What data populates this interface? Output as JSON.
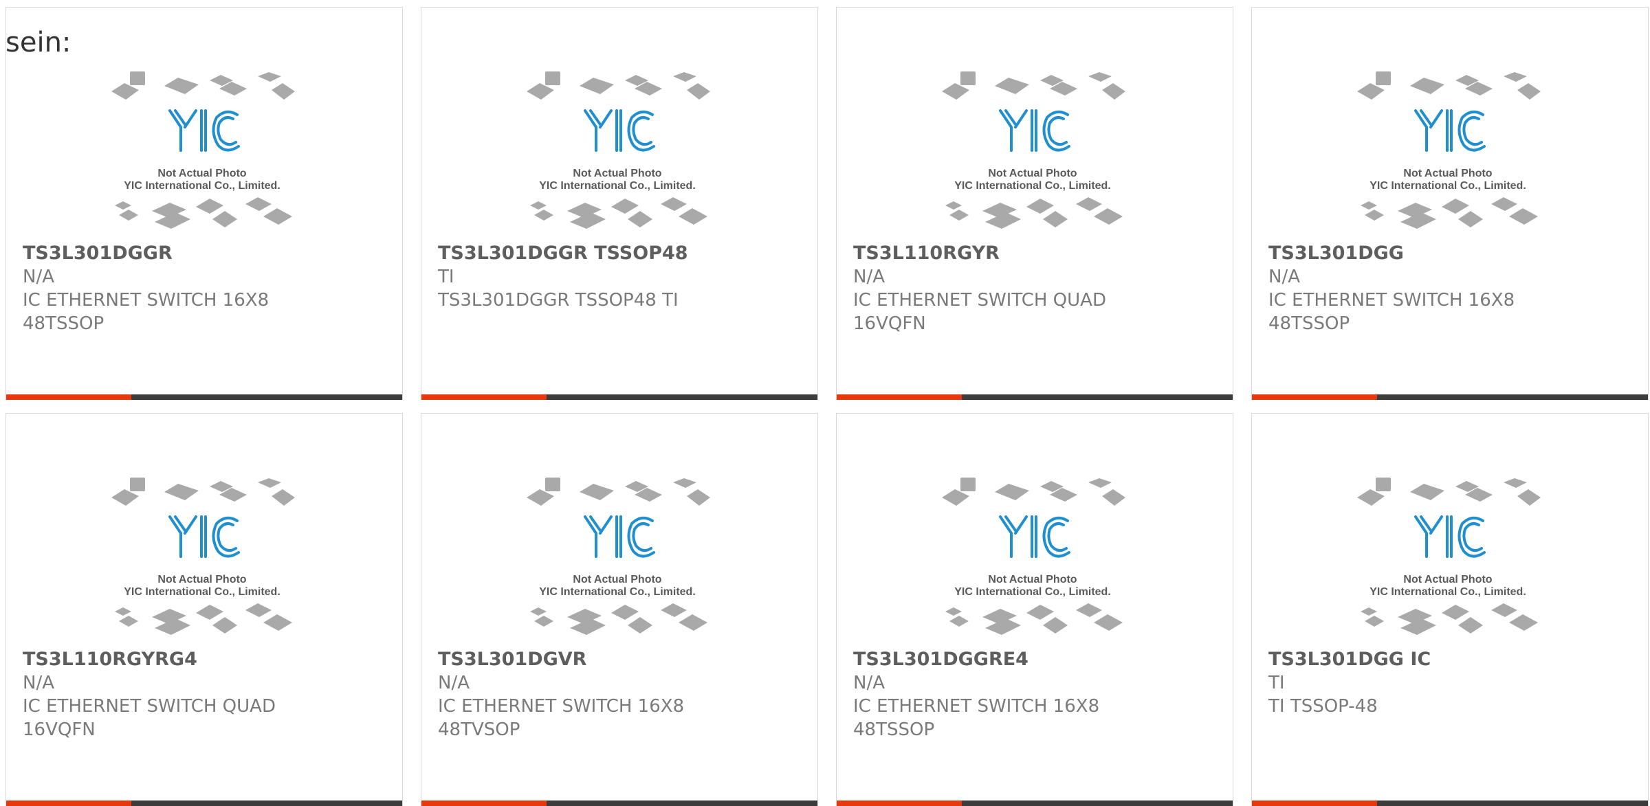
{
  "intro_text": "sein:",
  "watermark": {
    "logo": "YIC",
    "line1": "Not Actual Photo",
    "line2": "YIC International Co., Limited."
  },
  "colors": {
    "accent": "#e8380d",
    "bar": "#3c3c3c",
    "logo_blue": "#1f8fd0"
  },
  "products": [
    {
      "part": "TS3L301DGGR",
      "mfr": "N/A",
      "desc1": "IC ETHERNET SWITCH 16X8",
      "desc2": "48TSSOP"
    },
    {
      "part": "TS3L301DGGR TSSOP48",
      "mfr": "TI",
      "desc1": "TS3L301DGGR TSSOP48 TI",
      "desc2": ""
    },
    {
      "part": "TS3L110RGYR",
      "mfr": "N/A",
      "desc1": "IC ETHERNET SWITCH QUAD",
      "desc2": "16VQFN"
    },
    {
      "part": "TS3L301DGG",
      "mfr": "N/A",
      "desc1": "IC ETHERNET SWITCH 16X8",
      "desc2": "48TSSOP"
    },
    {
      "part": "TS3L110RGYRG4",
      "mfr": "N/A",
      "desc1": "IC ETHERNET SWITCH QUAD",
      "desc2": "16VQFN"
    },
    {
      "part": "TS3L301DGVR",
      "mfr": "N/A",
      "desc1": "IC ETHERNET SWITCH 16X8",
      "desc2": "48TVSOP"
    },
    {
      "part": "TS3L301DGGRE4",
      "mfr": "N/A",
      "desc1": "IC ETHERNET SWITCH 16X8",
      "desc2": "48TSSOP"
    },
    {
      "part": "TS3L301DGG IC",
      "mfr": "TI",
      "desc1": "TI TSSOP-48",
      "desc2": ""
    }
  ]
}
